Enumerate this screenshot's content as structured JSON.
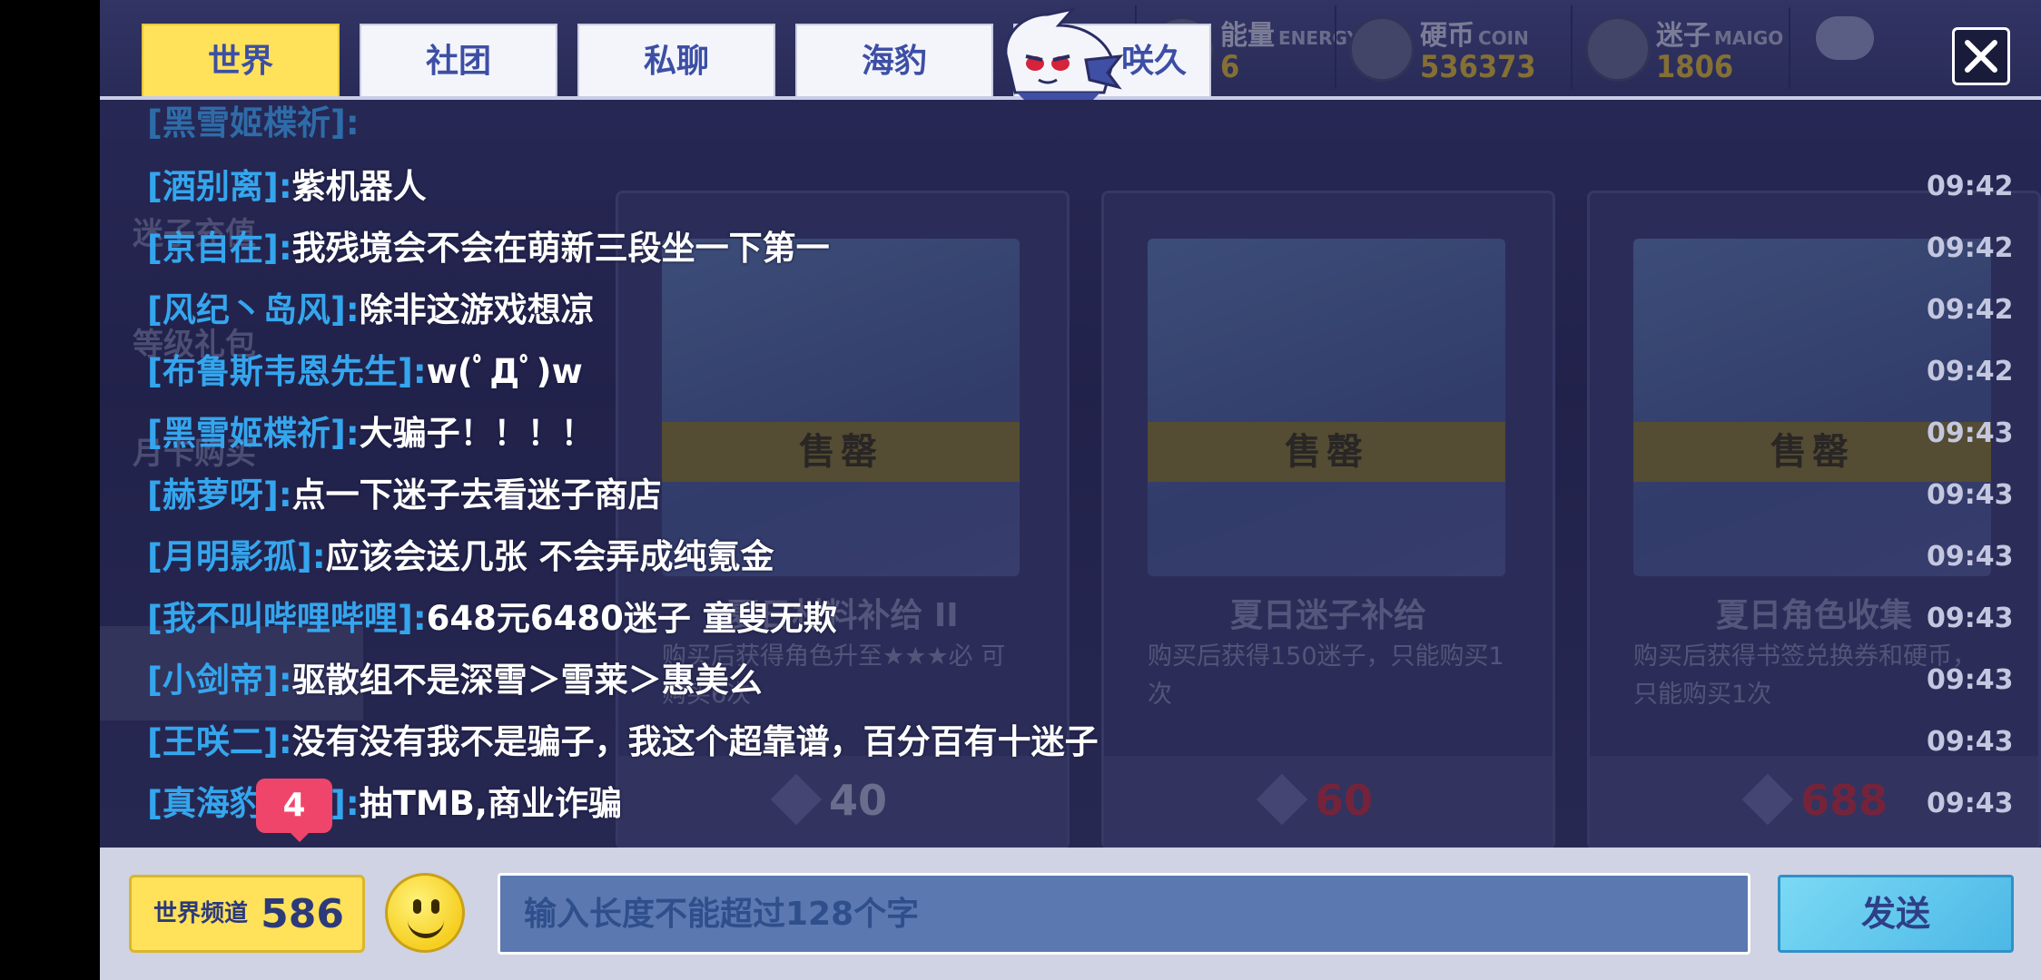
{
  "tabs": [
    "世界",
    "社团",
    "私聊",
    "海豹",
    "咲久"
  ],
  "active_tab": 0,
  "resources": [
    {
      "name": "能量",
      "en": "ENERGY",
      "value": "6",
      "icon": "energy-icon"
    },
    {
      "name": "硬币",
      "en": "COIN",
      "value": "536373",
      "icon": "coin-icon"
    },
    {
      "name": "迷子",
      "en": "MAIGO",
      "value": "1806",
      "icon": "maigo-gem-icon"
    }
  ],
  "shop_sidebar": [
    "迷子充值",
    "等级礼包",
    "月卡购买"
  ],
  "shop_cards": [
    {
      "title": "夏日材料补给 II",
      "desc": "购买后获得角色升至★★★必 可购买6次",
      "sold": "售罄",
      "price": "40",
      "price_color": "#b9bcd9"
    },
    {
      "title": "夏日迷子补给",
      "desc": "购买后获得150迷子，只能购买1次",
      "sold": "售罄",
      "price": "60",
      "price_color": "#c8313d"
    },
    {
      "title": "夏日角色收集",
      "desc": "购买后获得书签兑换券和硬币，只能购买1次",
      "sold": "售罄",
      "price": "688",
      "price_color": "#c8313d"
    }
  ],
  "messages": [
    {
      "user": "[酒别离]:",
      "text": "紫机器人",
      "time": "09:42"
    },
    {
      "user": "[京自在]:",
      "text": "我残境会不会在萌新三段坐一下第一",
      "time": "09:42"
    },
    {
      "user": "[风纪丶岛风]:",
      "text": "除非这游戏想凉",
      "time": "09:42"
    },
    {
      "user": "[布鲁斯韦恩先生]:",
      "text": "w(ﾟДﾟ)w",
      "time": "09:42"
    },
    {
      "user": "[黑雪姬楪祈]:",
      "text": "大骗子！！！！",
      "time": "09:43"
    },
    {
      "user": "[赫萝呀]:",
      "text": "点一下迷子去看迷子商店",
      "time": "09:43"
    },
    {
      "user": "[月明影孤]:",
      "text": "应该会送几张  不会弄成纯氪金",
      "time": "09:43"
    },
    {
      "user": "[我不叫哔哩哔哩]:",
      "text": "648元6480迷子 童叟无欺",
      "time": "09:43"
    },
    {
      "user": "[小剑帝]:",
      "text": "驱散组不是深雪＞雪莱＞惠美么",
      "time": "09:43"
    },
    {
      "user": "[王咲二]:",
      "text": "没有没有我不是骗子，我这个超靠谱，百分百有十迷子",
      "time": "09:43"
    },
    {
      "user": "[真海豹出击]:",
      "text": "抽TMB,商业诈骗",
      "time": "09:43"
    }
  ],
  "unread_badge": "4",
  "channel": {
    "label": "世界频道",
    "count": "586"
  },
  "input": {
    "placeholder": "输入长度不能超过128个字",
    "value": ""
  },
  "send_label": "发送",
  "colors": {
    "tab_active": "#ffe25a",
    "username": "#34a6ee",
    "send": "#4cb8e6"
  }
}
